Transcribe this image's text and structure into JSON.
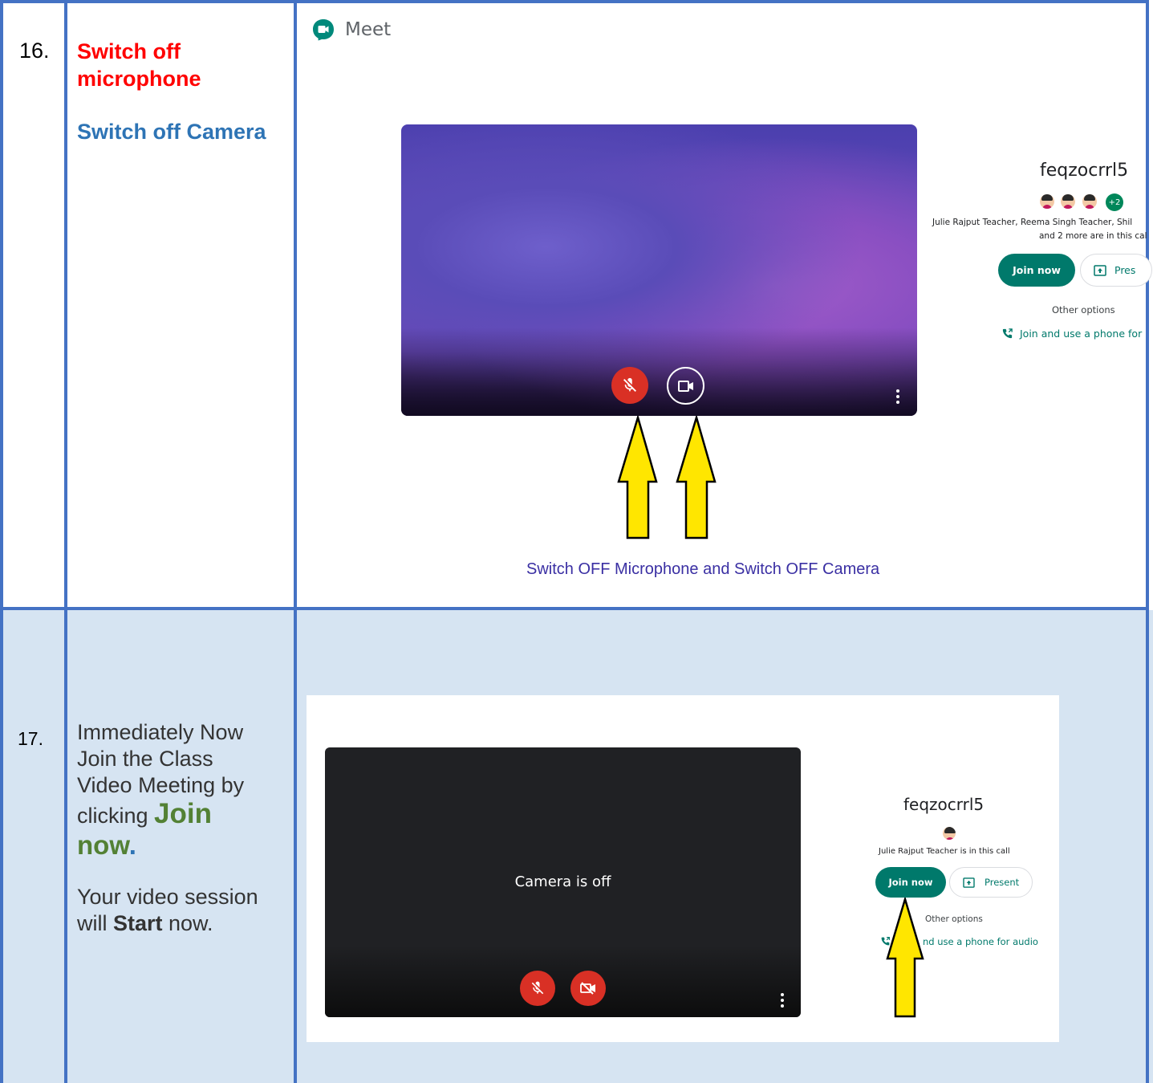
{
  "rows": [
    {
      "number": "16.",
      "title_line1": "Switch off",
      "title_line2": "microphone",
      "subtitle": "Switch off Camera",
      "caption": "Switch OFF Microphone and Switch OFF Camera"
    },
    {
      "number": "17.",
      "line1": "Immediately Now",
      "line2": "Join the Class",
      "line3": "Video Meeting by",
      "line4_prefix": "clicking ",
      "join_word": "Join",
      "now_word": "now",
      "now_dot": ".",
      "line5": "Your video session",
      "line6_prefix": "will ",
      "start_word": "Start",
      "line6_suffix": " now."
    }
  ],
  "screenshot1": {
    "app_name": "Meet",
    "meeting_code": "feqzocrrl5",
    "extra_participants": "+2",
    "participants_line1": "Julie Rajput Teacher, Reema Singh Teacher, Shil",
    "participants_line2": "and 2 more are in this cal",
    "join_button": "Join now",
    "present_button": "Pres",
    "other_options": "Other options",
    "phone_option": "Join and use a phone for"
  },
  "screenshot2": {
    "camera_status": "Camera is off",
    "meeting_code": "feqzocrrl5",
    "participants_line": "Julie Rajput Teacher is in this call",
    "join_button": "Join now",
    "present_button": "Present",
    "other_options": "Other options",
    "phone_option": "nd use a phone for audio"
  },
  "colors": {
    "table_border": "#4472c4",
    "row2_background": "#d6e4f2",
    "red_heading": "#ff0000",
    "blue_heading": "#2e74b5",
    "green_join": "#538135",
    "meet_green": "#00796b",
    "arrow_yellow": "#ffe600",
    "mic_red": "#d93025"
  }
}
